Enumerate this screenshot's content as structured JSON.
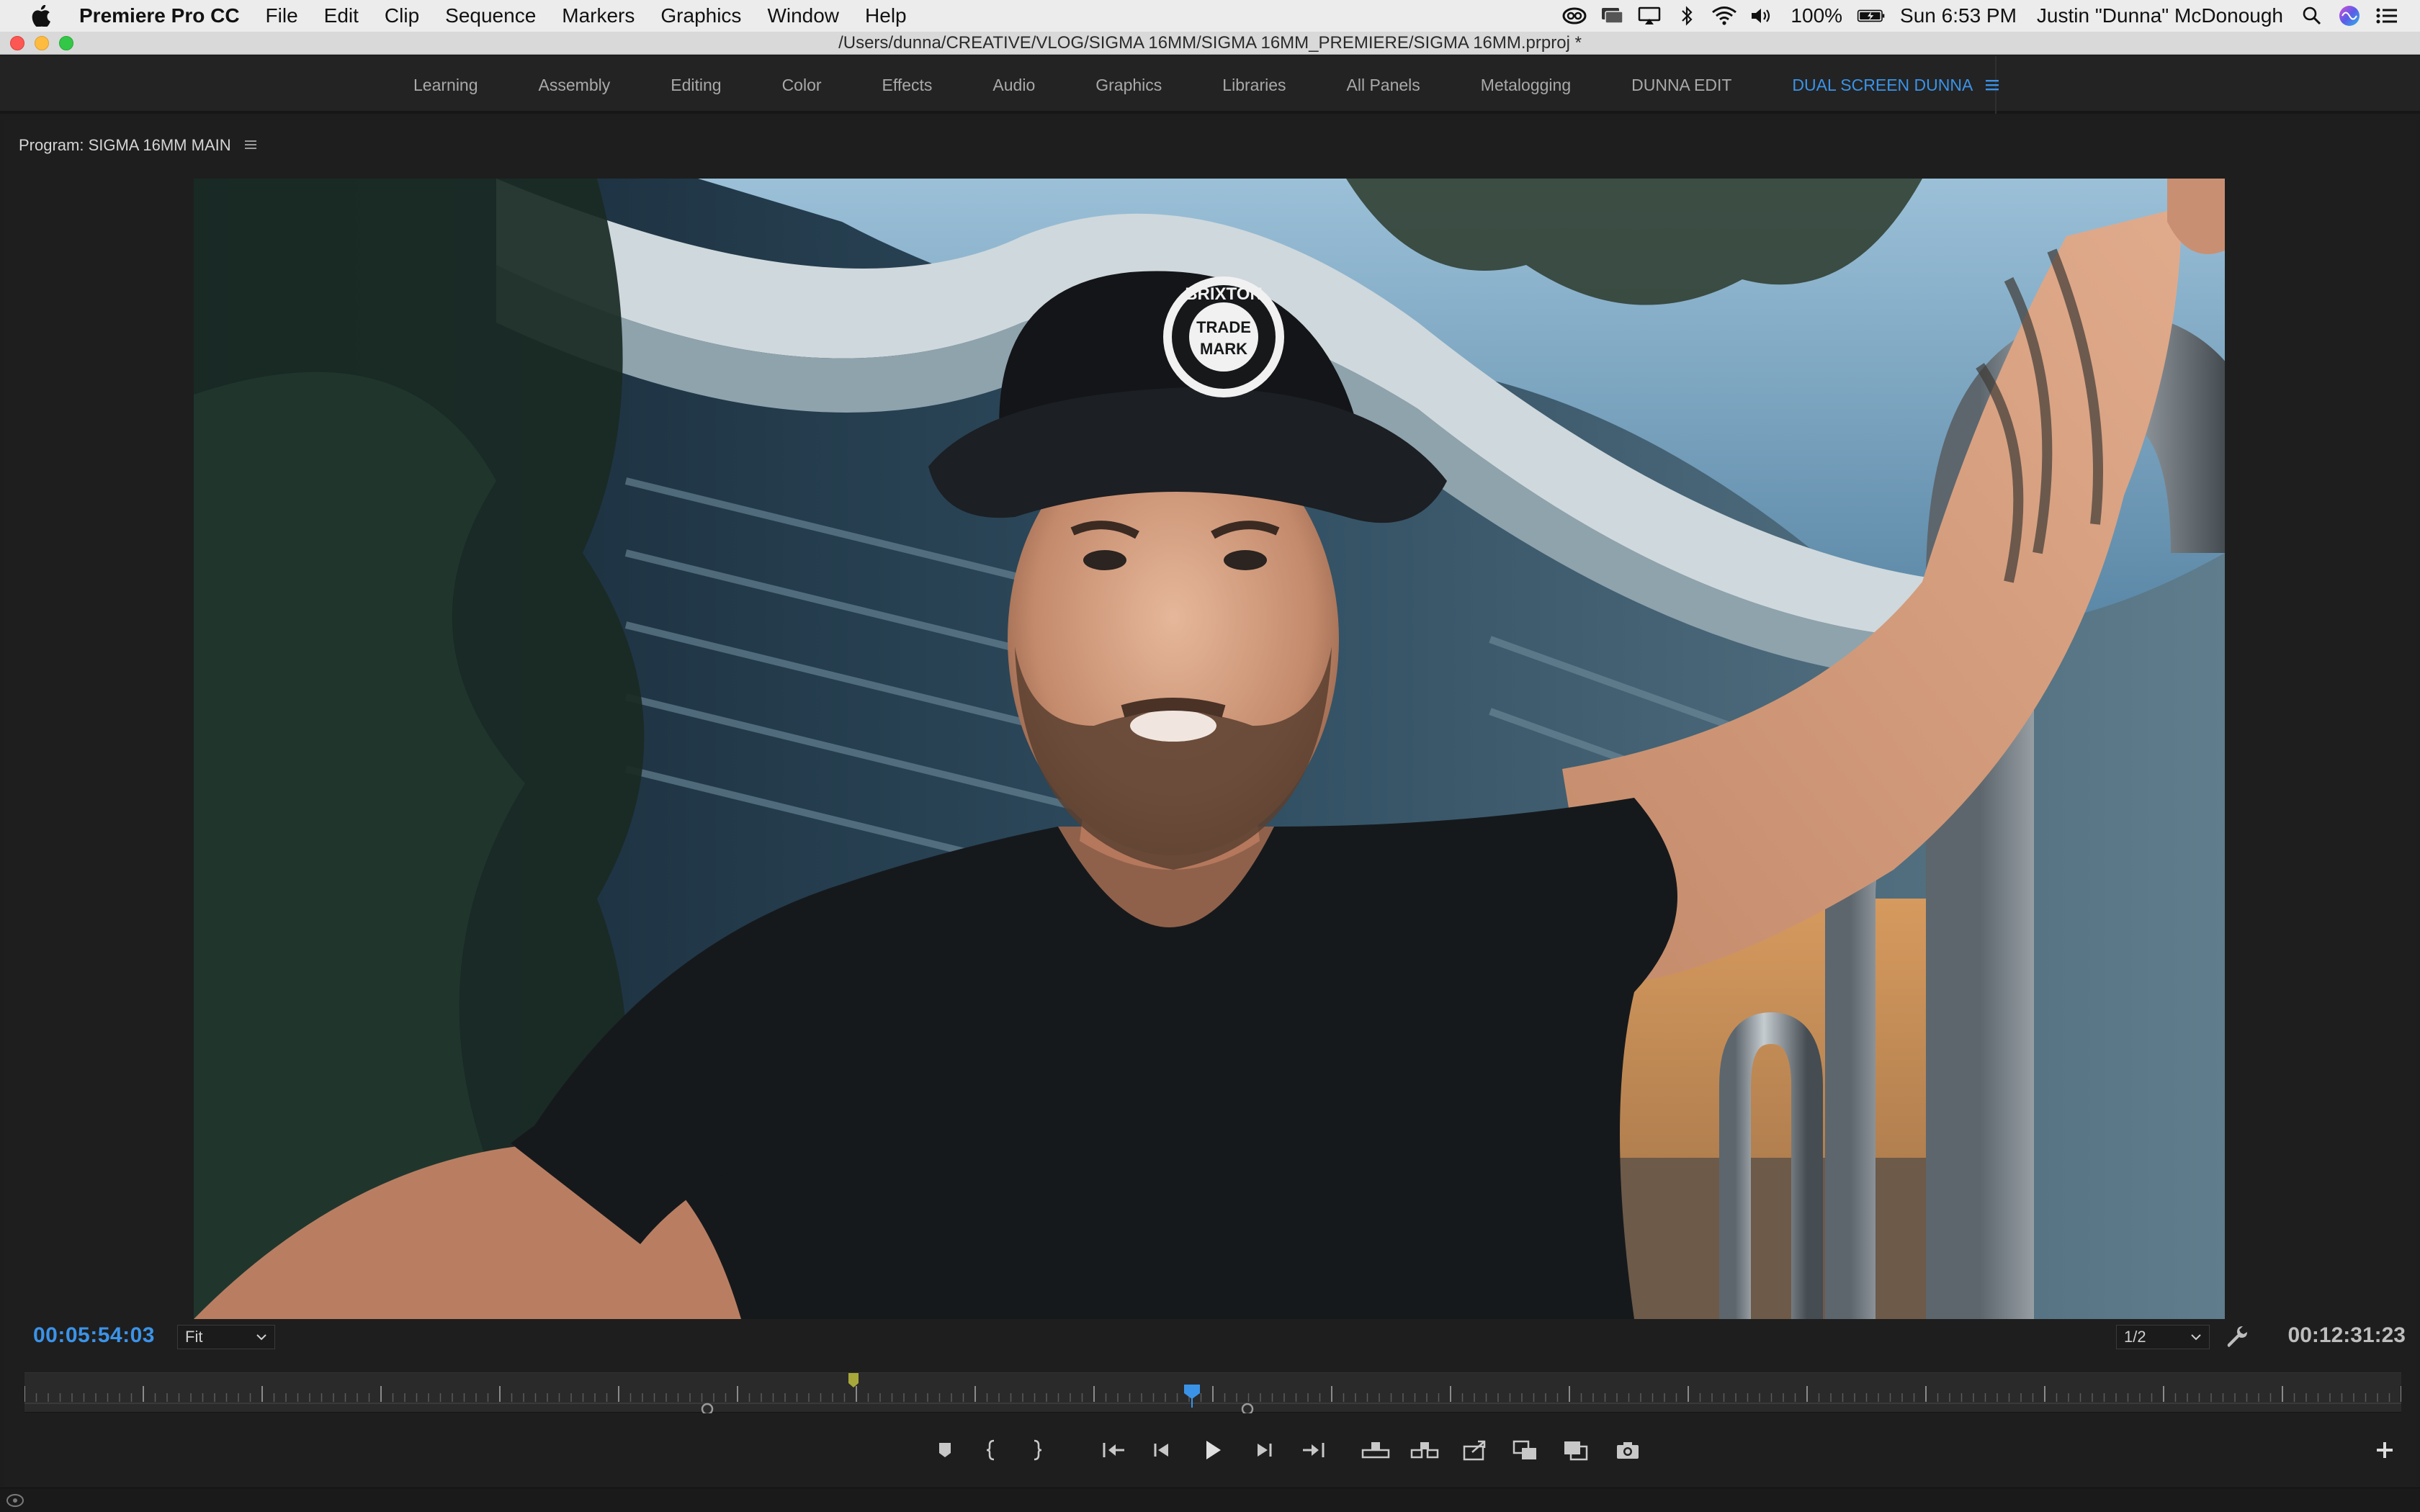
{
  "menubar": {
    "app_name": "Premiere Pro CC",
    "items": [
      "File",
      "Edit",
      "Clip",
      "Sequence",
      "Markers",
      "Graphics",
      "Window",
      "Help"
    ],
    "battery": "100%",
    "clock": "Sun 6:53 PM",
    "user": "Justin \"Dunna\" McDonough",
    "status_icons": [
      "creative-cloud-icon",
      "monitor-icon",
      "airplay-icon",
      "bluetooth-icon",
      "wifi-icon",
      "volume-icon",
      "battery-icon",
      "search-icon",
      "siri-icon",
      "notification-center-icon"
    ]
  },
  "window": {
    "title": "/Users/dunna/CREATIVE/VLOG/SIGMA 16MM/SIGMA 16MM_PREMIERE/SIGMA 16MM.prproj *"
  },
  "workspaces": {
    "tabs": [
      "Learning",
      "Assembly",
      "Editing",
      "Color",
      "Effects",
      "Audio",
      "Graphics",
      "Libraries",
      "All Panels",
      "Metalogging",
      "DUNNA EDIT",
      "DUAL SCREEN DUNNA"
    ],
    "active": "DUAL SCREEN DUNNA",
    "accent": "#3b93e8"
  },
  "program_monitor": {
    "title": "Program: SIGMA 16MM MAIN",
    "current_timecode": "00:05:54:03",
    "duration_timecode": "00:12:31:23",
    "zoom": "Fit",
    "resolution": "1/2",
    "frame_cap_text": [
      "BRIXTON",
      "TRADE",
      "MARK"
    ],
    "transport_buttons": [
      "add-marker-button",
      "mark-in-button",
      "mark-out-button",
      "go-to-in-button",
      "step-back-button",
      "play-button",
      "step-forward-button",
      "go-to-out-button",
      "lift-button",
      "extract-button",
      "export-frame-button",
      "insert-button",
      "overwrite-button",
      "camera-button"
    ]
  },
  "colors": {
    "timecode_blue": "#3b93e8",
    "panel_bg": "#1e1e1e",
    "marker_yellow": "#a8a83a"
  }
}
